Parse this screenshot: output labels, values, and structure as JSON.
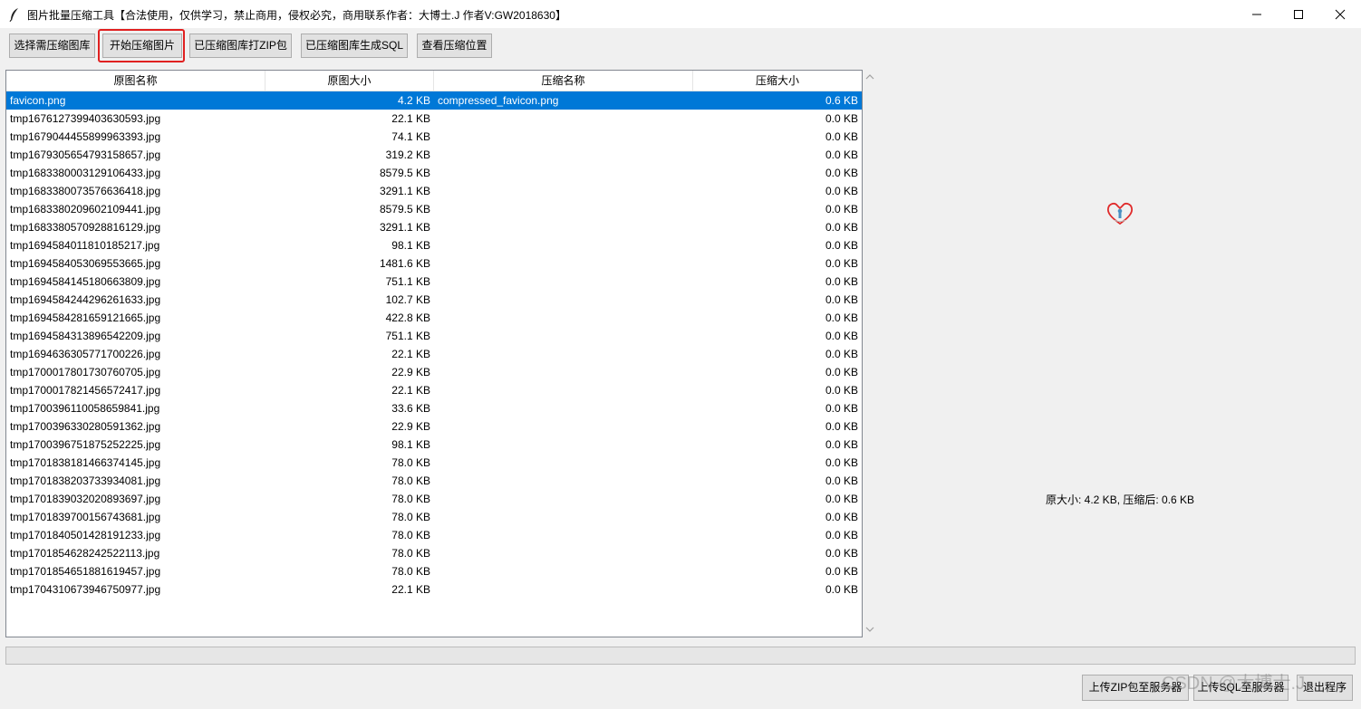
{
  "window": {
    "title": "图片批量压缩工具【合法使用，仅供学习，禁止商用，侵权必究，商用联系作者：大博士.J 作者V:GW2018630】"
  },
  "toolbar": {
    "select_label": "选择需压缩图库",
    "start_label": "开始压缩图片",
    "zip_label": "已压缩图库打ZIP包",
    "sql_label": "已压缩图库生成SQL",
    "view_label": "查看压缩位置"
  },
  "table": {
    "headers": [
      "原图名称",
      "原图大小",
      "压缩名称",
      "压缩大小"
    ],
    "rows": [
      {
        "name": "favicon.png",
        "size": "4.2 KB",
        "cname": "compressed_favicon.png",
        "csize": "0.6 KB"
      },
      {
        "name": "tmp1676127399403630593.jpg",
        "size": "22.1 KB",
        "cname": "",
        "csize": "0.0 KB"
      },
      {
        "name": "tmp1679044455899963393.jpg",
        "size": "74.1 KB",
        "cname": "",
        "csize": "0.0 KB"
      },
      {
        "name": "tmp1679305654793158657.jpg",
        "size": "319.2 KB",
        "cname": "",
        "csize": "0.0 KB"
      },
      {
        "name": "tmp1683380003129106433.jpg",
        "size": "8579.5 KB",
        "cname": "",
        "csize": "0.0 KB"
      },
      {
        "name": "tmp1683380073576636418.jpg",
        "size": "3291.1 KB",
        "cname": "",
        "csize": "0.0 KB"
      },
      {
        "name": "tmp1683380209602109441.jpg",
        "size": "8579.5 KB",
        "cname": "",
        "csize": "0.0 KB"
      },
      {
        "name": "tmp1683380570928816129.jpg",
        "size": "3291.1 KB",
        "cname": "",
        "csize": "0.0 KB"
      },
      {
        "name": "tmp1694584011810185217.jpg",
        "size": "98.1 KB",
        "cname": "",
        "csize": "0.0 KB"
      },
      {
        "name": "tmp1694584053069553665.jpg",
        "size": "1481.6 KB",
        "cname": "",
        "csize": "0.0 KB"
      },
      {
        "name": "tmp1694584145180663809.jpg",
        "size": "751.1 KB",
        "cname": "",
        "csize": "0.0 KB"
      },
      {
        "name": "tmp1694584244296261633.jpg",
        "size": "102.7 KB",
        "cname": "",
        "csize": "0.0 KB"
      },
      {
        "name": "tmp1694584281659121665.jpg",
        "size": "422.8 KB",
        "cname": "",
        "csize": "0.0 KB"
      },
      {
        "name": "tmp1694584313896542209.jpg",
        "size": "751.1 KB",
        "cname": "",
        "csize": "0.0 KB"
      },
      {
        "name": "tmp1694636305771700226.jpg",
        "size": "22.1 KB",
        "cname": "",
        "csize": "0.0 KB"
      },
      {
        "name": "tmp1700017801730760705.jpg",
        "size": "22.9 KB",
        "cname": "",
        "csize": "0.0 KB"
      },
      {
        "name": "tmp1700017821456572417.jpg",
        "size": "22.1 KB",
        "cname": "",
        "csize": "0.0 KB"
      },
      {
        "name": "tmp1700396110058659841.jpg",
        "size": "33.6 KB",
        "cname": "",
        "csize": "0.0 KB"
      },
      {
        "name": "tmp1700396330280591362.jpg",
        "size": "22.9 KB",
        "cname": "",
        "csize": "0.0 KB"
      },
      {
        "name": "tmp1700396751875252225.jpg",
        "size": "98.1 KB",
        "cname": "",
        "csize": "0.0 KB"
      },
      {
        "name": "tmp1701838181466374145.jpg",
        "size": "78.0 KB",
        "cname": "",
        "csize": "0.0 KB"
      },
      {
        "name": "tmp1701838203733934081.jpg",
        "size": "78.0 KB",
        "cname": "",
        "csize": "0.0 KB"
      },
      {
        "name": "tmp1701839032020893697.jpg",
        "size": "78.0 KB",
        "cname": "",
        "csize": "0.0 KB"
      },
      {
        "name": "tmp1701839700156743681.jpg",
        "size": "78.0 KB",
        "cname": "",
        "csize": "0.0 KB"
      },
      {
        "name": "tmp1701840501428191233.jpg",
        "size": "78.0 KB",
        "cname": "",
        "csize": "0.0 KB"
      },
      {
        "name": "tmp1701854628242522113.jpg",
        "size": "78.0 KB",
        "cname": "",
        "csize": "0.0 KB"
      },
      {
        "name": "tmp1701854651881619457.jpg",
        "size": "78.0 KB",
        "cname": "",
        "csize": "0.0 KB"
      },
      {
        "name": "tmp1704310673946750977.jpg",
        "size": "22.1 KB",
        "cname": "",
        "csize": "0.0 KB"
      }
    ]
  },
  "preview": {
    "info": "原大小: 4.2 KB, 压缩后: 0.6 KB"
  },
  "bottom": {
    "upload_zip_label": "上传ZIP包至服务器",
    "upload_sql_label": "上传SQL至服务器",
    "exit_label": "退出程序"
  },
  "watermark": "CSDN @大博士.J",
  "colors": {
    "selection": "#0078d7",
    "highlight_border": "#e02020"
  },
  "icons": [
    "feather-app-icon",
    "minimize-icon",
    "maximize-icon",
    "close-icon",
    "chevron-up-icon",
    "chevron-down-icon",
    "heart-favicon-icon"
  ]
}
